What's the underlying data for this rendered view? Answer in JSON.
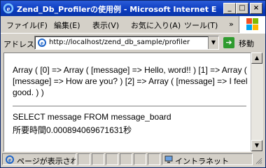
{
  "window": {
    "title": "Zend_Db_Profilerの使用例 - Microsoft Internet E...",
    "controls": {
      "minimize": "_",
      "maximize": "□",
      "close": "×"
    }
  },
  "menu": {
    "items": [
      "ファイル(F)",
      "編集(E)",
      "表示(V)",
      "お気に入り(A)",
      "ツール(T)"
    ],
    "overflow": "»"
  },
  "address": {
    "label": "アドレス(D)",
    "url": "http://localhost/zend_db_sample/profiler",
    "go_label": "移動"
  },
  "page": {
    "array_output": "Array ( [0] => Array ( [message] => Hello, word!! ) [1] => Array ( [message] => How are you? ) [2] => Array ( [message] => I feel good. ) )",
    "sql": "SELECT message FROM message_board",
    "elapsed": "所要時間0.000894069671631秒"
  },
  "status": {
    "text": "ページが表示されました",
    "zone": "イントラネット"
  },
  "colors": {
    "titlebar": "#0b3bbf",
    "chrome": "#d4d0c8",
    "go_button": "#2f9b2f"
  }
}
